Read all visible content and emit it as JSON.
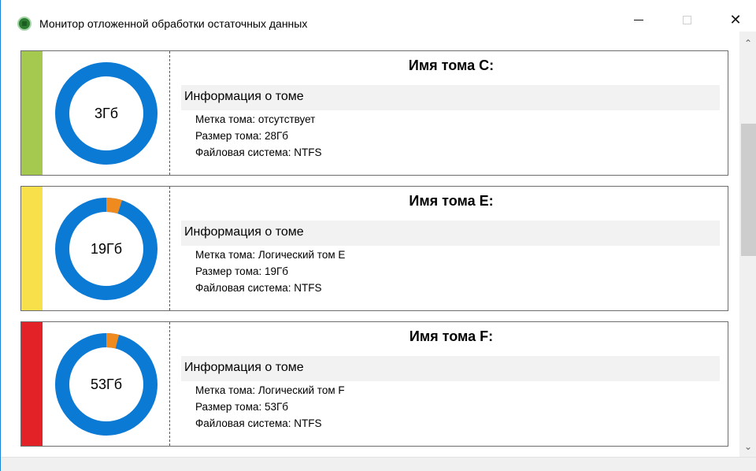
{
  "window": {
    "title": "Монитор отложенной обработки остаточных данных",
    "icon": "app-disk-icon",
    "controls": {
      "minimize": "minimize-icon",
      "maximize": "maximize-icon",
      "close": "close-icon",
      "close_glyph": "✕"
    }
  },
  "volumes": [
    {
      "name": "Имя тома C:",
      "status_color": "#a5c94e",
      "donut_label": "3Гб",
      "free_fraction": 0.0,
      "info_header": "Информация о томе",
      "label_line": "Метка тома: отсутствует",
      "size_line": "Размер тома: 28Гб",
      "fs_line": "Файловая система: NTFS"
    },
    {
      "name": "Имя тома E:",
      "status_color": "#f8e04a",
      "donut_label": "19Гб",
      "free_fraction": 0.05,
      "info_header": "Информация о томе",
      "label_line": "Метка тома: Логический том E",
      "size_line": "Размер тома: 19Гб",
      "fs_line": "Файловая система: NTFS"
    },
    {
      "name": "Имя тома F:",
      "status_color": "#e22227",
      "donut_label": "53Гб",
      "free_fraction": 0.04,
      "info_header": "Информация о томе",
      "label_line": "Метка тома: Логический том F",
      "size_line": "Размер тома: 53Гб",
      "fs_line": "Файловая система: NTFS"
    }
  ],
  "colors": {
    "donut_used": "#0a7ad5",
    "donut_free": "#ee8a1e",
    "window_border": "#1883d7"
  },
  "scrollbar": {
    "up_glyph": "⌃",
    "down_glyph": "⌄"
  }
}
